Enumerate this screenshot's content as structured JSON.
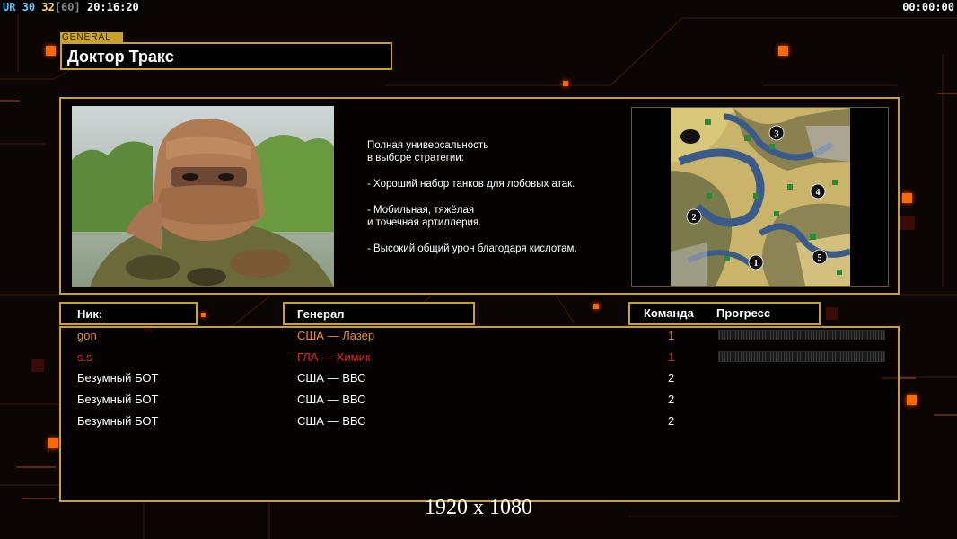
{
  "hud": {
    "fps_label": "UR",
    "fps_a": "30",
    "fps_b": "32",
    "fps_c": "[60]",
    "clock": "20:16:20",
    "timer": "00:00:00"
  },
  "general_tag": "GENERAL",
  "general_name": "Доктор Тракс",
  "description": [
    "Полная универсальность",
    "в выборе стратегии:",
    "",
    "- Хороший набор танков для лобовых атак.",
    "",
    "- Мобильная, тяжёлая",
    "и точечная артиллерия.",
    "",
    "- Высокий общий урон благодаря кислотам."
  ],
  "map_positions": [
    "1",
    "2",
    "3",
    "4",
    "5"
  ],
  "columns": {
    "nick": "Ник:",
    "general": "Генерал",
    "team": "Команда",
    "progress": "Прогресс"
  },
  "players": [
    {
      "nick": "gon",
      "general": "США — Лазер",
      "team": "1",
      "color": "#e8902a",
      "progress": 0
    },
    {
      "nick": "s.s",
      "general": "ГЛА — Химик",
      "team": "1",
      "color": "#e0262a",
      "progress": 0
    },
    {
      "nick": "Безумный БОТ",
      "general": "США — ВВС",
      "team": "2",
      "color": "#ffffff"
    },
    {
      "nick": "Безумный БОТ",
      "general": "США — ВВС",
      "team": "2",
      "color": "#ffffff"
    },
    {
      "nick": "Безумный БОТ",
      "general": "США — ВВС",
      "team": "2",
      "color": "#ffffff"
    }
  ],
  "resolution_caption": "1920 x 1080",
  "colors": {
    "frame": "#c8a22a",
    "accent": "#ff6a00"
  }
}
